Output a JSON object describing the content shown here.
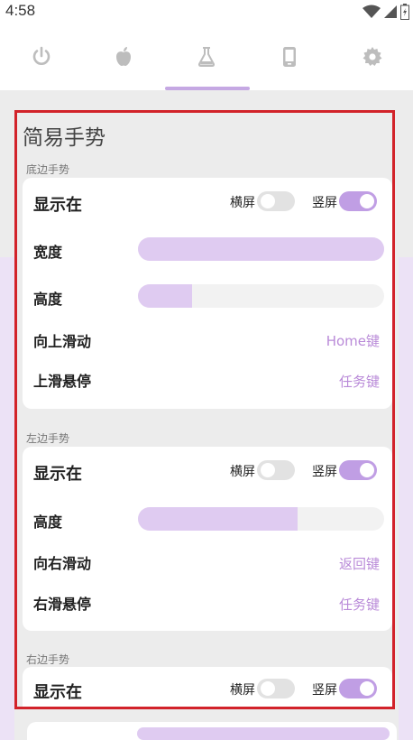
{
  "status": {
    "time": "4:58",
    "icons": [
      "wifi-icon",
      "cell-signal-icon",
      "battery-icon"
    ]
  },
  "tabs": [
    {
      "icon": "power-icon",
      "selected": false
    },
    {
      "icon": "apple-icon",
      "selected": false
    },
    {
      "icon": "flask-icon",
      "selected": true
    },
    {
      "icon": "phone-icon",
      "selected": false
    },
    {
      "icon": "gear-icon",
      "selected": false
    }
  ],
  "colors": {
    "accent": "#c09ee4",
    "slider_fill": "#dfcbf1",
    "value_text": "#b98ad8",
    "highlight_border": "#d2232a"
  },
  "page": {
    "title": "简易手势",
    "bottom": {
      "label": "底边手势",
      "show_on": "显示在",
      "landscape": "横屏",
      "portrait": "竖屏",
      "landscape_on": false,
      "portrait_on": true,
      "width_label": "宽度",
      "width_level": 1.0,
      "height_label": "高度",
      "height_level": 0.22,
      "swipe_up_label": "向上滑动",
      "swipe_up_value": "Home键",
      "hover_label": "上滑悬停",
      "hover_value": "任务键"
    },
    "left": {
      "label": "左边手势",
      "show_on": "显示在",
      "landscape": "横屏",
      "portrait": "竖屏",
      "landscape_on": false,
      "portrait_on": true,
      "height_label": "高度",
      "height_level": 0.65,
      "swipe_label": "向右滑动",
      "swipe_value": "返回键",
      "hover_label": "右滑悬停",
      "hover_value": "任务键"
    },
    "right": {
      "label": "右边手势",
      "show_on": "显示在",
      "landscape": "横屏",
      "portrait": "竖屏",
      "landscape_on": false,
      "portrait_on": true
    }
  }
}
